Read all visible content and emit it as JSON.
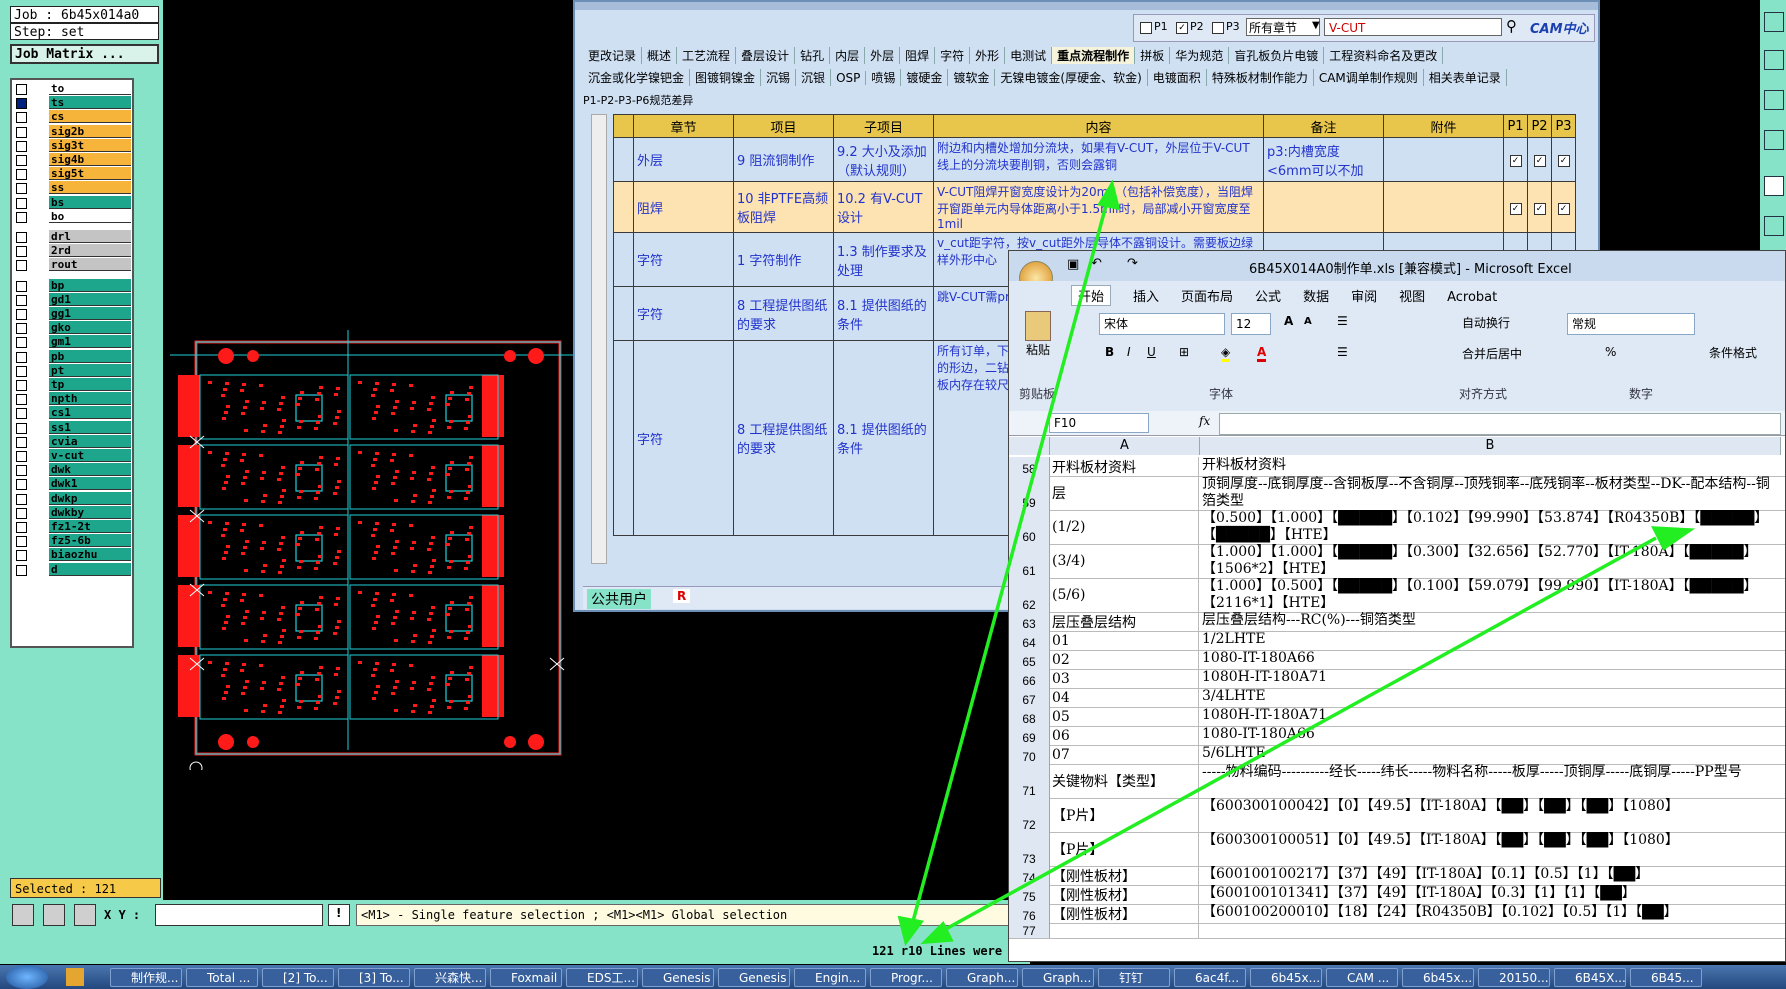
{
  "genesis": {
    "job_line": "Job : 6b45x014a0",
    "step_line": "Step: set",
    "job_matrix_button": "Job Matrix ...",
    "selected_line": "Selected : 121",
    "xy_label": "X Y :",
    "status_message": "<M1> - Single feature selection ; <M1><M1> Global selection",
    "bottom_message": "121 r10 Lines were",
    "layers": [
      {
        "name": "to",
        "color": "#ffffff"
      },
      {
        "name": "ts",
        "color": "#1ea68c"
      },
      {
        "name": "cs",
        "color": "#f6b43a"
      },
      {
        "name": "sig2b",
        "color": "#f6b43a"
      },
      {
        "name": "sig3t",
        "color": "#f6b43a"
      },
      {
        "name": "sig4b",
        "color": "#f6b43a"
      },
      {
        "name": "sig5t",
        "color": "#f6b43a"
      },
      {
        "name": "ss",
        "color": "#f6b43a"
      },
      {
        "name": "bs",
        "color": "#1ea68c"
      },
      {
        "name": "bo",
        "color": "#ffffff"
      },
      {
        "name": "drl",
        "color": "#c4c4c4"
      },
      {
        "name": "2rd",
        "color": "#c4c4c4"
      },
      {
        "name": "rout",
        "color": "#c4c4c4"
      },
      {
        "name": "bp",
        "color": "#1ea68c"
      },
      {
        "name": "gd1",
        "color": "#1ea68c"
      },
      {
        "name": "gg1",
        "color": "#1ea68c"
      },
      {
        "name": "gko",
        "color": "#1ea68c"
      },
      {
        "name": "gm1",
        "color": "#1ea68c"
      },
      {
        "name": "pb",
        "color": "#1ea68c"
      },
      {
        "name": "pt",
        "color": "#1ea68c"
      },
      {
        "name": "tp",
        "color": "#1ea68c"
      },
      {
        "name": "npth",
        "color": "#1ea68c"
      },
      {
        "name": "cs1",
        "color": "#1ea68c"
      },
      {
        "name": "ss1",
        "color": "#1ea68c"
      },
      {
        "name": "cvia",
        "color": "#1ea68c"
      },
      {
        "name": "v-cut",
        "color": "#1ea68c"
      },
      {
        "name": "dwk",
        "color": "#1ea68c"
      },
      {
        "name": "dwk1",
        "color": "#1ea68c"
      },
      {
        "name": "dwkp",
        "color": "#1ea68c"
      },
      {
        "name": "dwkby",
        "color": "#1ea68c"
      },
      {
        "name": "fz1-2t",
        "color": "#1ea68c"
      },
      {
        "name": "fz5-6b",
        "color": "#1ea68c"
      },
      {
        "name": "biaozhu",
        "color": "#1ea68c"
      },
      {
        "name": "d",
        "color": "#1ea68c"
      }
    ]
  },
  "doc": {
    "filters": {
      "p1": "P1",
      "p2": "P2",
      "p3": "P3",
      "chapter_select": "所有章节",
      "search_value": "V-CUT",
      "brand": "CAM中心"
    },
    "menu_row1": [
      "更改记录",
      "概述",
      "工艺流程",
      "叠层设计",
      "钻孔",
      "内层",
      "外层",
      "阻焊",
      "字符",
      "外形",
      "电测试",
      "重点流程制作",
      "拼板",
      "华为规范",
      "盲孔板负片电镀",
      "工程资料命名及更改"
    ],
    "menu_row2": [
      "沉金或化学镍钯金",
      "图镀铜镍金",
      "沉锡",
      "沉银",
      "OSP",
      "喷锡",
      "镀硬金",
      "镀软金",
      "无镍电镀金(厚硬金、软金)",
      "电镀面积",
      "特殊板材制作能力",
      "CAM调单制作规则",
      "相关表单记录"
    ],
    "menu_row3": "P1-P2-P3-P6规范差异",
    "headers": [
      "章节",
      "项目",
      "子项目",
      "内容",
      "备注",
      "附件",
      "P1",
      "P2",
      "P3"
    ],
    "rows": [
      {
        "chapter": "外层",
        "item": "9 阻流铜制作",
        "sub": "9.2 大小及添加（默认规则）",
        "content": "附边和内槽处增加分流块，如果有V-CUT，外层位于V-CUT线上的分流块要削铜，否则会露铜",
        "note": "p3:内槽宽度<6mm可以不加",
        "checks": true
      },
      {
        "chapter": "阻焊",
        "item": "10 非PTFE高频板阻焊",
        "sub": "10.2 有V-CUT设计",
        "content": "V-CUT阻焊开窗宽度设计为20mil（包括补偿宽度），当阻焊开窗距单元内导体距离小于1.5mil时，局部减小开窗宽度至1mil",
        "note": "",
        "checks": true
      },
      {
        "chapter": "字符",
        "item": "1 字符制作",
        "sub": "1.3 制作要求及处理",
        "content": "v_cut距字符，按v_cut距外层导体不露铜设计。需要板边绿样外形中心",
        "note": "",
        "checks": false
      },
      {
        "chapter": "字符",
        "item": "8 工程提供图纸的要求",
        "sub": "8.1 提供图纸的条件",
        "content": "跳V-CUT需profile，V-CUT层对片。如附图",
        "note": "",
        "checks": false
      },
      {
        "chapter": "字符",
        "item": "8 工程提供图纸的要求",
        "sub": "8.1 提供图纸的条件",
        "content": "所有订单，下：1）标注尺寸宽、交货板测试孔或者角反光点的形边，二钻时，二钻到样优选距离槽铣孔到外连铣槽宽、板内存在较尺寸）等。2）标注尺寸",
        "note": "",
        "checks": false
      }
    ],
    "footer_user": "公共用户",
    "footer_badge": "R"
  },
  "excel": {
    "title": "6B45X014A0制作单.xls [兼容模式] - Microsoft Excel",
    "tabs": [
      "开始",
      "插入",
      "页面布局",
      "公式",
      "数据",
      "审阅",
      "视图",
      "Acrobat"
    ],
    "font_name": "宋体",
    "font_size": "12",
    "wrap_text": "自动换行",
    "merge_center": "合并后居中",
    "number_format": "常规",
    "conditional_format": "条件格式",
    "groups": [
      "剪贴板",
      "字体",
      "对齐方式",
      "数字"
    ],
    "paste_label": "粘贴",
    "name_box": "F10",
    "fx_label": "fx",
    "col_a": "A",
    "col_b": "B",
    "rows": [
      {
        "n": "58",
        "a": "开料板材资料",
        "b": "开料板材资料"
      },
      {
        "n": "59",
        "a": "层",
        "b": "顶铜厚度--底铜厚度--含铜板厚--不含铜厚--顶残铜率--底残铜率--板材类型--DK--配本结构--铜箔类型"
      },
      {
        "n": "60",
        "a": "(1/2)",
        "b": "【0.500】【1.000】【█████】【0.102】【99.990】【53.874】【R04350B】【█████】【█████】【HTE】"
      },
      {
        "n": "61",
        "a": "(3/4)",
        "b": "【1.000】【1.000】【█████】【0.300】【32.656】【52.770】【IT-180A】【█████】【1506*2】【HTE】"
      },
      {
        "n": "62",
        "a": "(5/6)",
        "b": "【1.000】【0.500】【█████】【0.100】【59.079】【99.990】【IT-180A】【█████】【2116*1】【HTE】"
      },
      {
        "n": "63",
        "a": "层压叠层结构",
        "b": "层压叠层结构---RC(%)---铜箔类型"
      },
      {
        "n": "64",
        "a": "01",
        "b": "1/2LHTE"
      },
      {
        "n": "65",
        "a": "02",
        "b": "1080-IT-180A66"
      },
      {
        "n": "66",
        "a": "03",
        "b": "1080H-IT-180A71"
      },
      {
        "n": "67",
        "a": "04",
        "b": "3/4LHTE"
      },
      {
        "n": "68",
        "a": "05",
        "b": "1080H-IT-180A71"
      },
      {
        "n": "69",
        "a": "06",
        "b": "1080-IT-180A66"
      },
      {
        "n": "70",
        "a": "07",
        "b": "5/6LHTE"
      },
      {
        "n": "71",
        "a": "关键物料【类型】",
        "b": "-----物料编码----------经长-----纬长-----物料名称-----板厚-----顶铜厚-----底铜厚-----PP型号"
      },
      {
        "n": "72",
        "a": "【P片】",
        "b": "【600300100042】【0】【49.5】【IT-180A】【██】【██】【██】【1080】"
      },
      {
        "n": "73",
        "a": "【P片】",
        "b": "【600300100051】【0】【49.5】【IT-180A】【██】【██】【██】【1080】"
      },
      {
        "n": "74",
        "a": "【刚性板材】",
        "b": "【600100100217】【37】【49】【IT-180A】【0.1】【0.5】【1】【██】"
      },
      {
        "n": "75",
        "a": "【刚性板材】",
        "b": "【600100101341】【37】【49】【IT-180A】【0.3】【1】【1】【██】"
      },
      {
        "n": "76",
        "a": "【刚性板材】",
        "b": "【600100200010】【18】【24】【R04350B】【0.102】【0.5】【1】【██】"
      },
      {
        "n": "77",
        "a": "",
        "b": ""
      }
    ]
  },
  "taskbar": {
    "items": [
      "制作规...",
      "Total ...",
      "[2] To...",
      "[3] To...",
      "兴森快...",
      "Foxmail",
      "EDS工...",
      "Genesis",
      "Genesis",
      "Engin...",
      "Progr...",
      "Graph...",
      "Graph...",
      "钉钉",
      "6ac4f...",
      "6b45x...",
      "CAM ...",
      "6b45x...",
      "20150...",
      "6B45X...",
      "6B45..."
    ]
  },
  "colors": {
    "genesis_panel": "#86e3c8",
    "pcb_red": "#ff1a1a",
    "pcb_cyan": "#21d1d8",
    "arrow_green": "#22ee22",
    "doc_header": "#e8c64c"
  }
}
